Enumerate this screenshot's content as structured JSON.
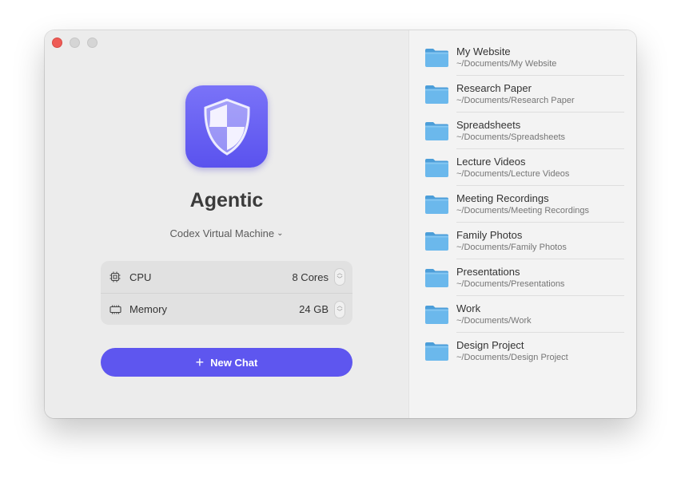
{
  "app": {
    "name": "Agentic",
    "icon": "shield-icon",
    "accent_color": "#5e56ef"
  },
  "vm_selector": {
    "label": "Codex Virtual Machine",
    "chevron": "⌄"
  },
  "specs": [
    {
      "icon": "cpu-icon",
      "label": "CPU",
      "value": "8 Cores"
    },
    {
      "icon": "memory-icon",
      "label": "Memory",
      "value": "24 GB"
    }
  ],
  "new_chat": {
    "plus": "+",
    "label": "New Chat"
  },
  "folders": [
    {
      "name": "My Website",
      "path": "~/Documents/My Website"
    },
    {
      "name": "Research Paper",
      "path": "~/Documents/Research Paper"
    },
    {
      "name": "Spreadsheets",
      "path": "~/Documents/Spreadsheets"
    },
    {
      "name": "Lecture Videos",
      "path": "~/Documents/Lecture Videos"
    },
    {
      "name": "Meeting Recordings",
      "path": "~/Documents/Meeting Recordings"
    },
    {
      "name": "Family Photos",
      "path": "~/Documents/Family Photos"
    },
    {
      "name": "Presentations",
      "path": "~/Documents/Presentations"
    },
    {
      "name": "Work",
      "path": "~/Documents/Work"
    },
    {
      "name": "Design Project",
      "path": "~/Documents/Design Project"
    }
  ]
}
